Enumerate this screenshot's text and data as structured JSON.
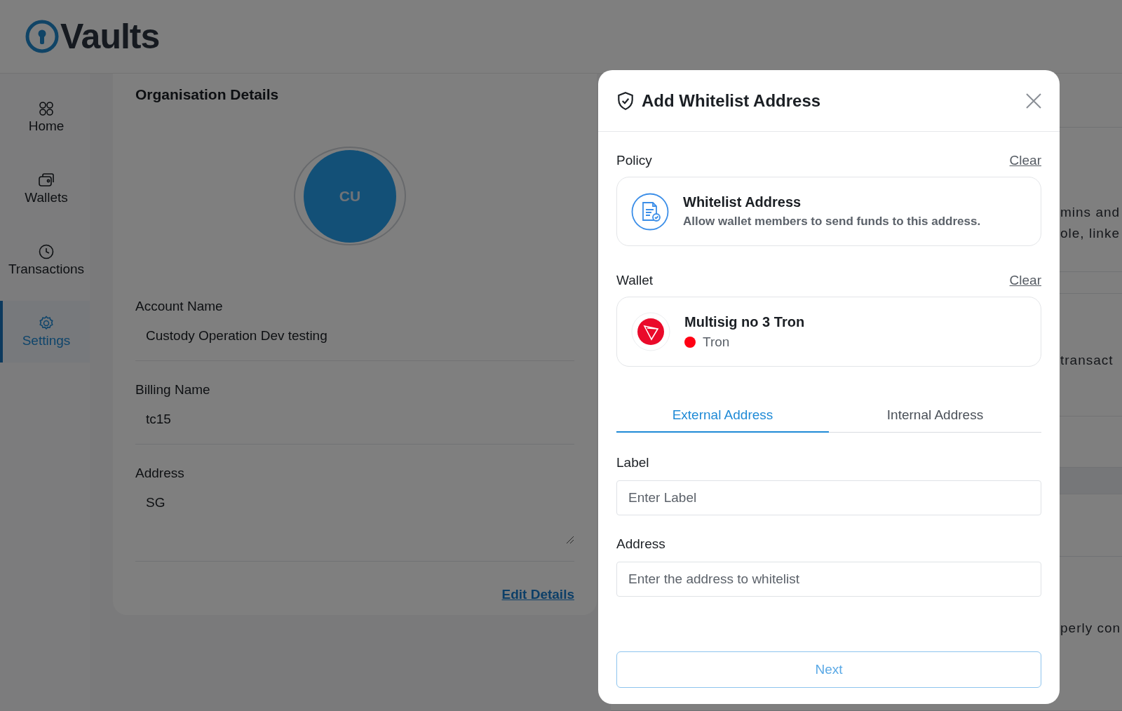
{
  "logo": {
    "text": "Vaults"
  },
  "sidebar": {
    "items": [
      {
        "label": "Home",
        "selected": false
      },
      {
        "label": "Wallets",
        "selected": false
      },
      {
        "label": "Transactions",
        "selected": false
      },
      {
        "label": "Settings",
        "selected": true
      }
    ]
  },
  "organisation": {
    "title": "Organisation Details",
    "avatar": "CU",
    "fields": [
      {
        "label": "Account Name",
        "value": "Custody Operation Dev testing",
        "kind": "text"
      },
      {
        "label": "Billing Name",
        "value": "tc15",
        "kind": "text"
      },
      {
        "label": "Address",
        "value": "SG",
        "kind": "textarea"
      }
    ],
    "edit_link": "Edit Details"
  },
  "background_panel": {
    "sections": [
      {
        "texts": [
          "mins and",
          "ole, linke"
        ]
      },
      {
        "texts": [
          "transact"
        ]
      },
      {
        "texts": [
          "perly con"
        ]
      }
    ]
  },
  "dialog": {
    "title": "Add Whitelist Address",
    "policy": {
      "label": "Policy",
      "clear": "Clear",
      "title": "Whitelist Address",
      "description": "Allow wallet members to send funds to this address."
    },
    "wallet": {
      "label": "Wallet",
      "clear": "Clear",
      "name": "Multisig no 3 Tron",
      "network": "Tron",
      "color": "#ff0013"
    },
    "tabs": [
      {
        "label": "External Address",
        "selected": true
      },
      {
        "label": "Internal Address",
        "selected": false
      }
    ],
    "fields": [
      {
        "label": "Label",
        "placeholder": "Enter Label"
      },
      {
        "label": "Address",
        "placeholder": "Enter the address to whitelist"
      }
    ],
    "next": "Next"
  }
}
